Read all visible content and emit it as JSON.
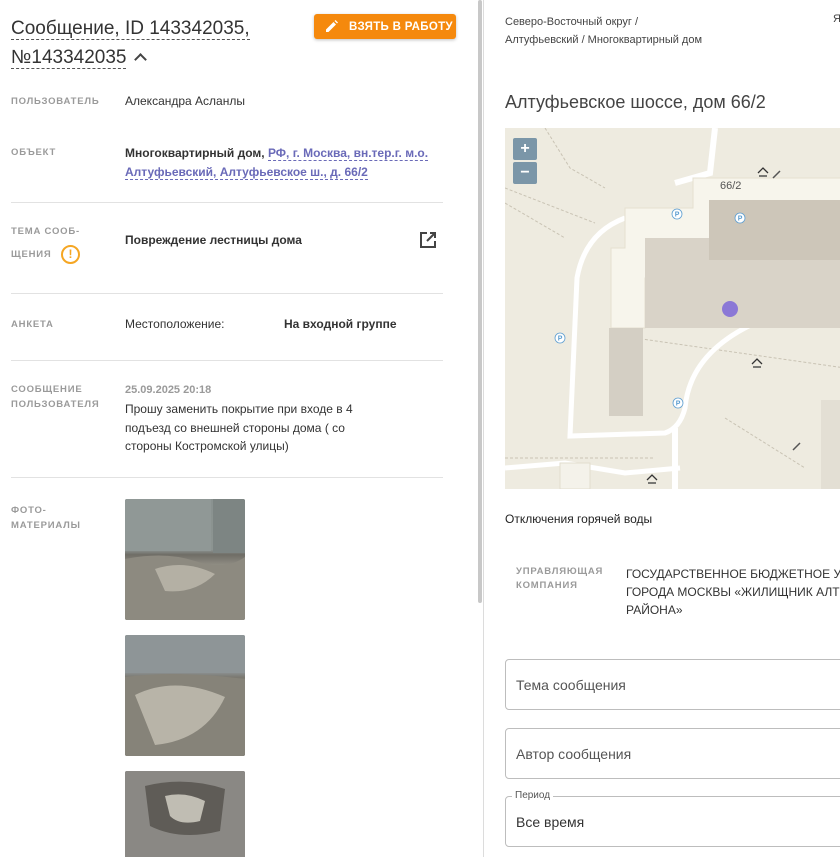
{
  "message": {
    "title_line1": "Сообщение, ID 143342035,",
    "title_line2": "№143342035",
    "take_button": "ВЗЯТЬ В РАБОТУ"
  },
  "fields": {
    "user_label": "ПОЛЬЗОВАТЕЛЬ",
    "user_value": "Александра Асланлы",
    "object_label": "ОБЪЕКТ",
    "object_type": "Многоквартирный дом,",
    "object_link": "РФ, г. Москва, вн.тер.г. м.о. Алтуфьевский, Алтуфьевское ш., д. 66/2",
    "topic_label_1": "ТЕМА СООБ-",
    "topic_label_2": "ЩЕНИЯ",
    "topic_value": "Повреждение лестницы дома",
    "survey_label": "АНКЕТА",
    "survey_key": "Местоположение:",
    "survey_value": "На входной группе",
    "msg_label_1": "СООБЩЕНИЕ",
    "msg_label_2": "ПОЛЬЗОВАТЕЛЯ",
    "msg_date": "25.09.2025 20:18",
    "msg_text": "Прошу заменить покрытие при входе в 4 подъезд со внешней стороны дома ( со стороны Костромской улицы)",
    "photo_label_1": "ФОТО-",
    "photo_label_2": "МАТЕРИАЛЫ"
  },
  "right": {
    "breadcrumb": "Северо-Восточный округ / Алтуфьевский / Многоквартирный дом",
    "ya": "Я",
    "address": "Алтуфьевское шоссе, дом 66/2",
    "map": {
      "house_label": "66/2",
      "zoom_in": "+",
      "zoom_out": "−",
      "parking": "P"
    },
    "hot_water": "Отключения горячей воды",
    "mc_label_1": "УПРАВЛЯЮЩАЯ",
    "mc_label_2": "КОМПАНИЯ",
    "mc_value": "ГОСУДАРСТВЕННОЕ БЮДЖЕТНОЕ УЧ ГОРОДА МОСКВЫ «ЖИЛИЩНИК АЛТ РАЙОНА»",
    "topic_placeholder": "Тема сообщения",
    "author_placeholder": "Автор сообщения",
    "period_label": "Период",
    "period_value": "Все время"
  },
  "colors": {
    "accent": "#f5890d",
    "link": "#6a6ab8",
    "warn": "#f5a623",
    "marker": "#8b78d6"
  }
}
